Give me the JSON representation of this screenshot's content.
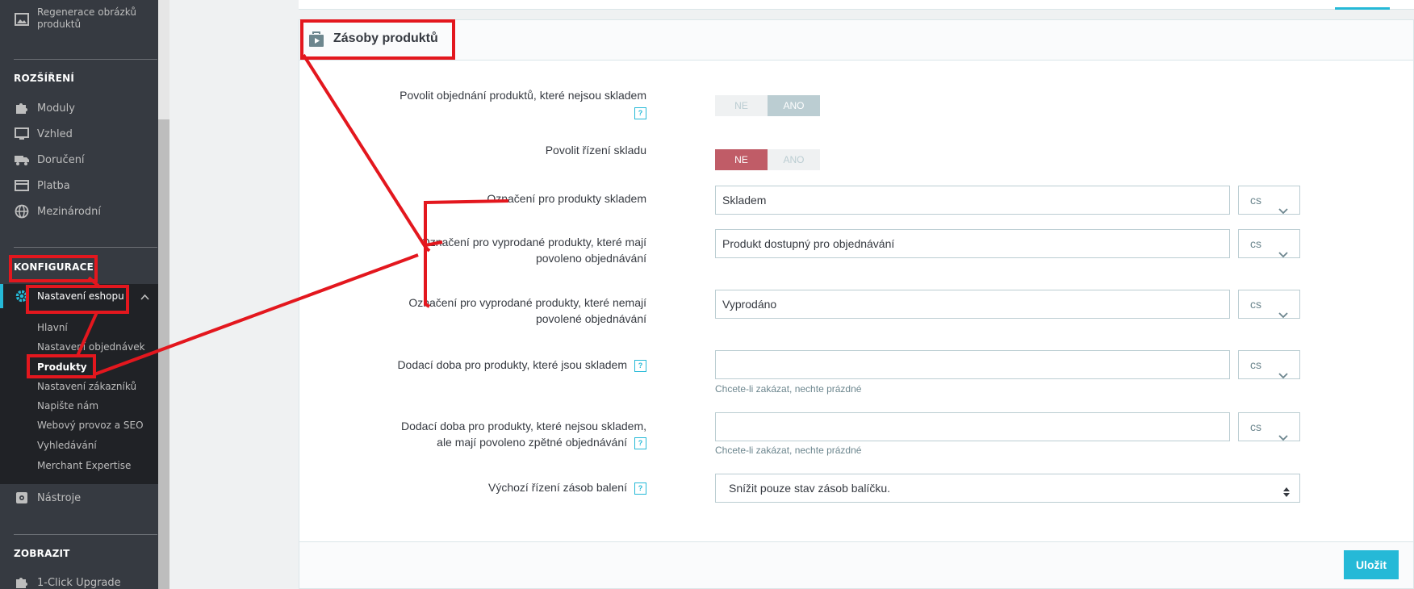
{
  "sidebar": {
    "top_item": "Regenerace obrázků produktů",
    "sections": {
      "extensions": "ROZŠÍŘENÍ",
      "configuration": "KONFIGURACE",
      "display": "ZOBRAZIT"
    },
    "extension_items": [
      "Moduly",
      "Vzhled",
      "Doručení",
      "Platba",
      "Mezinárodní"
    ],
    "shop_settings": "Nastavení eshopu",
    "sub_items": [
      "Hlavní",
      "Nastavení objednávek",
      "Produkty",
      "Nastavení zákazníků",
      "Napište nám",
      "Webový provoz a SEO",
      "Vyhledávání",
      "Merchant Expertise"
    ],
    "tools": "Nástroje",
    "upgrade": "1-Click Upgrade"
  },
  "panel": {
    "title": "Zásoby produktů",
    "help_glyph": "?",
    "save": "Uložit",
    "fields": {
      "allow_oos": {
        "label": "Povolit objednání produktů, které nejsou skladem",
        "no": "NE",
        "yes": "ANO",
        "value": "ANO"
      },
      "stock_mgmt": {
        "label": "Povolit řízení skladu",
        "no": "NE",
        "yes": "ANO",
        "value": "NE"
      },
      "label_in_stock": {
        "label": "Označení pro produkty skladem",
        "value": "Skladem",
        "lang": "cs"
      },
      "label_oos_allowed": {
        "label_line1": "Označení pro vyprodané produkty, které mají",
        "label_line2": "povoleno objednávání",
        "value": "Produkt dostupný pro objednávání",
        "lang": "cs"
      },
      "label_oos_denied": {
        "label_line1": "Označení pro vyprodané produkty, které nemají",
        "label_line2": "povolené objednávání",
        "value": "Vyprodáno",
        "lang": "cs"
      },
      "delivery_in_stock": {
        "label": "Dodací doba pro produkty, které jsou skladem",
        "value": "",
        "lang": "cs",
        "hint": "Chcete-li zakázat, nechte prázdné"
      },
      "delivery_oos": {
        "label_line1": "Dodací doba pro produkty, které nejsou skladem,",
        "label_line2": "ale mají povoleno zpětné objednávání",
        "value": "",
        "lang": "cs",
        "hint": "Chcete-li zakázat, nechte prázdné"
      },
      "pack_stock": {
        "label": "Výchozí řízení zásob balení",
        "value": "Snížit pouze stav zásob balíčku."
      }
    }
  },
  "colors": {
    "sidebar_bg": "#363a41",
    "accent": "#25b9d7",
    "toggle_red": "#c05c67",
    "annotation": "#e3171e"
  }
}
